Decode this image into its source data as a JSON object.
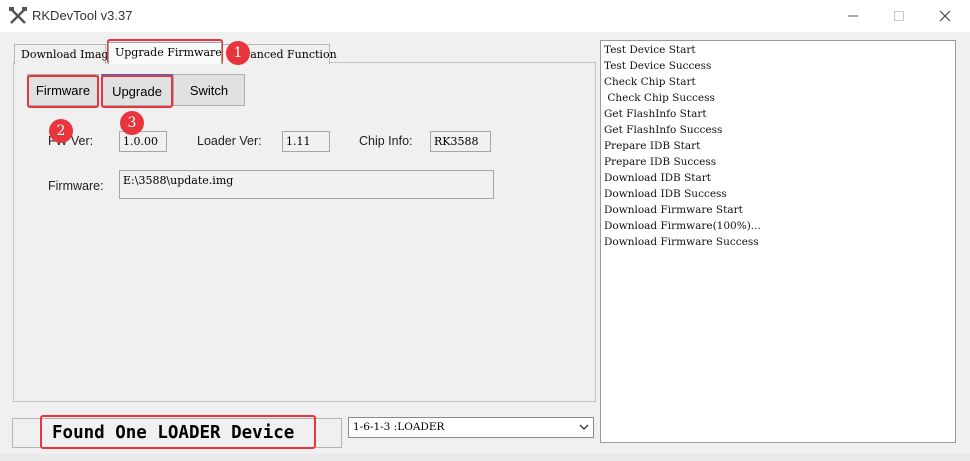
{
  "window": {
    "title": "RKDevTool v3.37",
    "icon": "crossed-tools-icon"
  },
  "tabs": [
    {
      "label": "Download Image",
      "selected": false
    },
    {
      "label": "Upgrade Firmware",
      "selected": true
    },
    {
      "label": "Advanced Function",
      "selected": false
    }
  ],
  "buttons": {
    "firmware": "Firmware",
    "upgrade": "Upgrade",
    "switch": "Switch"
  },
  "fields": {
    "fw_ver_label": "FW Ver:",
    "fw_ver_value": "1.0.00",
    "loader_ver_label": "Loader Ver:",
    "loader_ver_value": "1.11",
    "chip_info_label": "Chip Info:",
    "chip_info_value": "RK3588",
    "firmware_label": "Firmware:",
    "firmware_path": "E:\\3588\\update.img"
  },
  "status": {
    "text": "Found One LOADER Device"
  },
  "device_select": {
    "selected": "1-6-1-3 :LOADER"
  },
  "log": [
    "Test Device Start",
    "Test Device Success",
    "Check Chip Start",
    " Check Chip Success",
    "Get FlashInfo Start",
    "Get FlashInfo Success",
    "Prepare IDB Start",
    "Prepare IDB Success",
    "Download IDB Start",
    "Download IDB Success",
    "Download Firmware Start",
    "Download Firmware(100%)...",
    "Download Firmware Success"
  ],
  "annotations": [
    "1",
    "2",
    "3"
  ],
  "colors": {
    "annotation": "#e8343c",
    "upgrade_accent": "#2d6fd6"
  }
}
